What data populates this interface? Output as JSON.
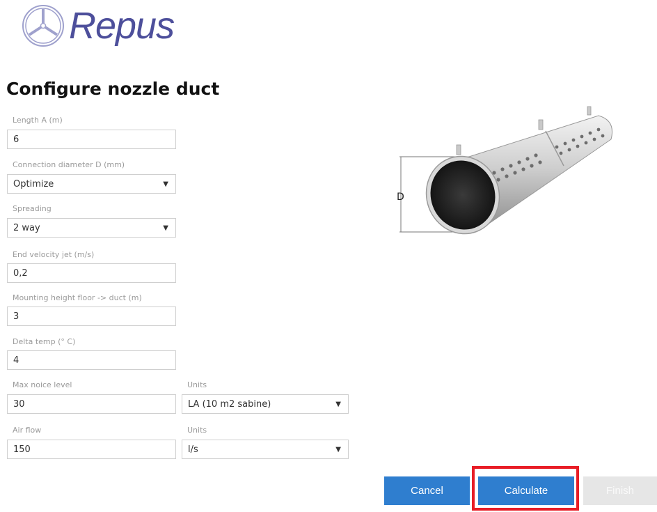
{
  "logo": {
    "text": "Repus"
  },
  "page_title": "Configure nozzle duct",
  "fields": {
    "length": {
      "label": "Length A (m)",
      "value": "6"
    },
    "diameter": {
      "label": "Connection diameter D (mm)",
      "value": "Optimize"
    },
    "spreading": {
      "label": "Spreading",
      "value": "2 way"
    },
    "end_velocity": {
      "label": "End velocity jet (m/s)",
      "value": "0,2"
    },
    "mounting_height": {
      "label": "Mounting height floor -> duct (m)",
      "value": "3"
    },
    "delta_temp": {
      "label": "Delta temp (° C)",
      "value": "4"
    },
    "max_noise": {
      "label": "Max noice level",
      "value": "30"
    },
    "noise_units": {
      "label": "Units",
      "value": "LA (10 m2 sabine)"
    },
    "air_flow": {
      "label": "Air flow",
      "value": "150"
    },
    "flow_units": {
      "label": "Units",
      "value": "l/s"
    }
  },
  "diagram": {
    "dimension_label": "D"
  },
  "buttons": {
    "cancel": "Cancel",
    "calculate": "Calculate",
    "finish": "Finish"
  },
  "colors": {
    "brand": "#4d4f9b",
    "primary": "#2f7ecf",
    "highlight": "#e81d26"
  }
}
